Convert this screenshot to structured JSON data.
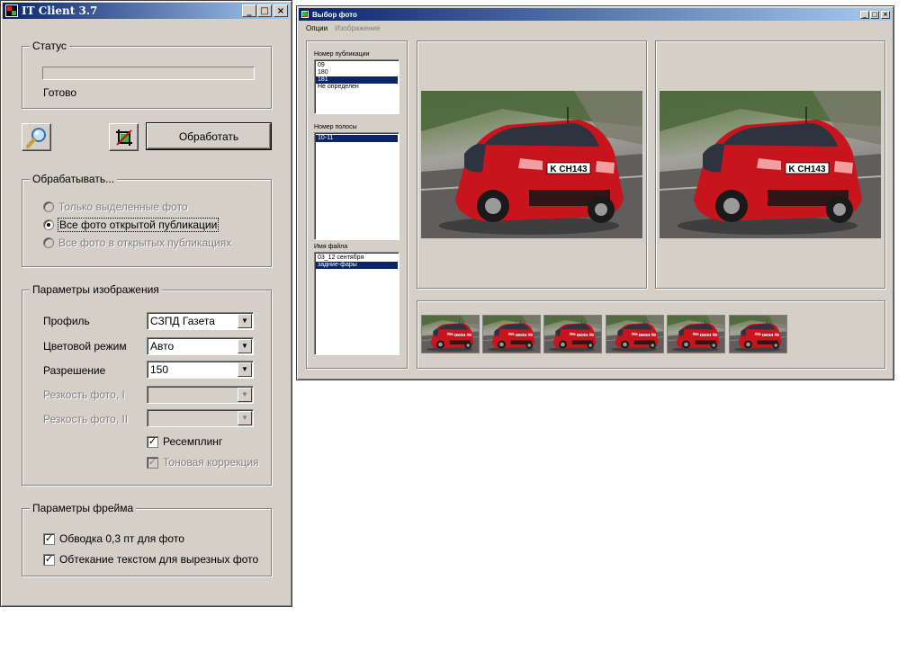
{
  "main_window": {
    "title": "IT Client 3.7",
    "status": {
      "label": "Статус",
      "text": "Готово"
    },
    "process_button": "Обработать",
    "process_group": {
      "label": "Обрабатывать...",
      "options": [
        {
          "label": "Только выделенные фото",
          "checked": false,
          "enabled": false
        },
        {
          "label": "Все фото открытой публикации",
          "checked": true,
          "enabled": true
        },
        {
          "label": "Все фото в открытых публикациях",
          "checked": false,
          "enabled": false
        }
      ]
    },
    "image_params": {
      "label": "Параметры изображения",
      "profile": {
        "label": "Профиль",
        "value": "СЗПД Газета"
      },
      "color_mode": {
        "label": "Цветовой режим",
        "value": "Авто"
      },
      "resolution": {
        "label": "Разрешение",
        "value": "150"
      },
      "sharpness1": {
        "label": "Резкость фото, I",
        "value": ""
      },
      "sharpness2": {
        "label": "Резкость фото, II",
        "value": ""
      },
      "resampling": {
        "label": "Ресемплинг",
        "checked": true
      },
      "tone_correction": {
        "label": "Тоновая коррекция",
        "checked": true,
        "enabled": false
      }
    },
    "frame_params": {
      "label": "Параметры фрейма",
      "stroke": {
        "label": "Обводка 0,3 пт для фото",
        "checked": true
      },
      "wrap": {
        "label": "Обтекание текстом для вырезных фото",
        "checked": true
      }
    }
  },
  "photo_window": {
    "title": "Выбор фото",
    "menu": [
      "Опции",
      "Изображение"
    ],
    "publication_number": {
      "label": "Номер публикации",
      "items": [
        "09",
        "180",
        "181",
        "Не определен"
      ],
      "selected": 2
    },
    "page_number": {
      "label": "Номер полосы",
      "items": [
        "10-11"
      ],
      "selected": 0
    },
    "file_name": {
      "label": "Имя файла",
      "items": [
        "03_12 сентября",
        "задние-фары"
      ],
      "selected": 1
    },
    "plate_text": "K CH143",
    "thumbnail_count": 6
  },
  "colors": {
    "title_start": "#0a246a",
    "title_end": "#a6caf0",
    "face": "#d4d0c8",
    "selection": "#0a246a",
    "car_red": "#c8141c"
  },
  "icons": {
    "search": "magnifier-icon",
    "crop": "crop-icon"
  }
}
